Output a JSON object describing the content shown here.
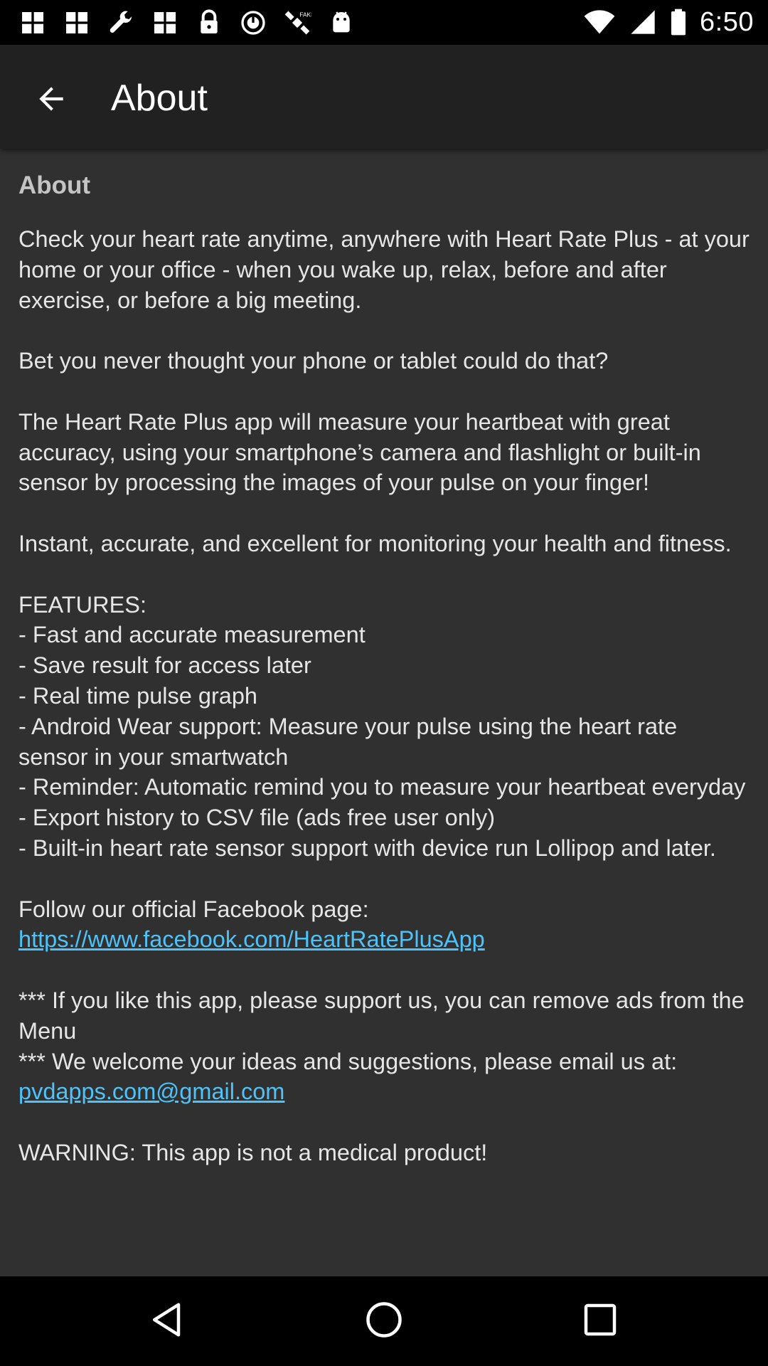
{
  "status_bar": {
    "time": "6:50",
    "icons": [
      "grid-icon",
      "grid-icon",
      "wrench-icon",
      "grid-icon",
      "lock-icon",
      "alarm-icon",
      "satellite-icon",
      "android-icon"
    ]
  },
  "app_bar": {
    "title": "About",
    "back_icon": "arrow-back-icon"
  },
  "content": {
    "heading": "About",
    "paragraph_1": "Check your heart rate anytime, anywhere with Heart Rate Plus - at your home or your office - when you wake up, relax, before and after exercise, or before a big meeting.",
    "paragraph_2": "Bet you never thought your phone or tablet could do that?",
    "paragraph_3": "The Heart Rate Plus app will measure your heartbeat with great accuracy, using your smartphone’s camera and flashlight or built-in sensor by processing the images of your pulse on your finger!",
    "paragraph_4": "Instant, accurate, and excellent for monitoring your health and fitness.",
    "features_heading": "FEATURES:",
    "features": [
      "- Fast and accurate measurement",
      "- Save result for access later",
      "- Real time pulse graph",
      "- Android Wear support: Measure your pulse using the heart rate sensor in your smartwatch",
      "- Reminder: Automatic remind you to measure your heartbeat everyday",
      "- Export history to CSV file (ads free user only)",
      "- Built-in heart rate sensor support with device run Lollipop and later."
    ],
    "facebook_prefix": "Follow our official Facebook page: ",
    "facebook_link": "https://www.facebook.com/HeartRatePlusApp",
    "support_line": "*** If you like this app, please support us, you can remove ads from the Menu",
    "email_prefix": "*** We welcome your ideas and suggestions, please email us at: ",
    "email_link": "pvdapps.com@gmail.com",
    "warning": "WARNING: This app is not a medical product!"
  },
  "nav_bar": {
    "back_icon": "triangle-back-icon",
    "home_icon": "circle-home-icon",
    "recents_icon": "square-recents-icon"
  },
  "colors": {
    "background": "#303030",
    "app_bar": "#212121",
    "link": "#4fc3f7",
    "heading": "#c4c4c4"
  }
}
